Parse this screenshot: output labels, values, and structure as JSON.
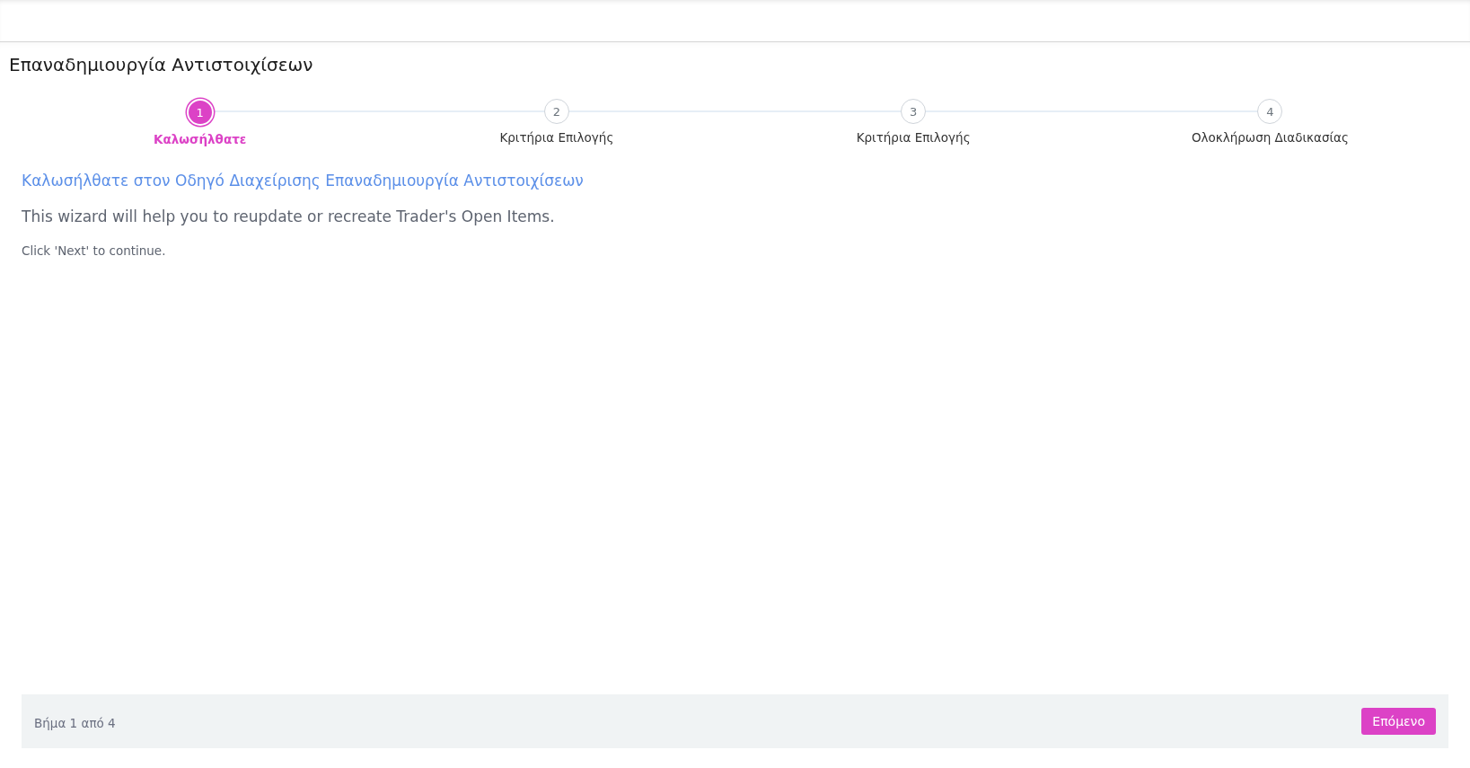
{
  "page_title": "Επαναδημιουργία Αντιστοιχίσεων",
  "steps": [
    {
      "number": "1",
      "label": "Καλωσήλθατε",
      "selected": true
    },
    {
      "number": "2",
      "label": "Κριτήρια Επιλογής",
      "selected": false
    },
    {
      "number": "3",
      "label": "Κριτήρια Επιλογής",
      "selected": false
    },
    {
      "number": "4",
      "label": "Ολοκλήρωση Διαδικασίας",
      "selected": false
    }
  ],
  "welcome_heading": "Καλωσήλθατε στον Οδηγό Διαχείρισης Επαναδημιουργία Αντιστοιχίσεων",
  "intro": "This wizard will help you to reupdate or recreate Trader's Open Items.",
  "hint": "Click 'Next' to continue.",
  "footer": {
    "step_info": "Βήμα 1 από 4",
    "next_button": "Επόμενο"
  }
}
